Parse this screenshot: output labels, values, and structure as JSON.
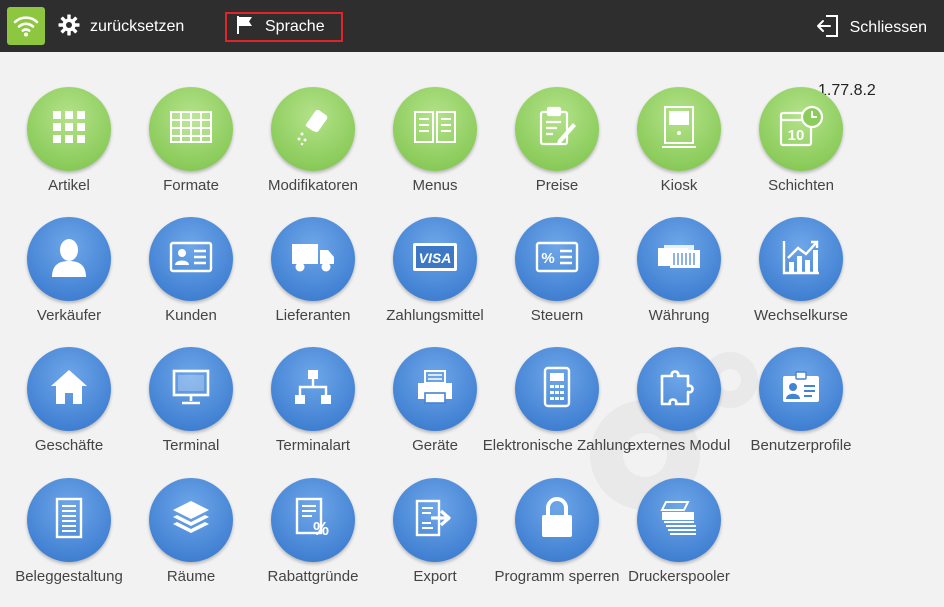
{
  "toolbar": {
    "reset_label": "zurücksetzen",
    "language_label": "Sprache",
    "close_label": "Schliessen"
  },
  "version": "1.77.8.2",
  "colors": {
    "accent_green": "#8dc63f",
    "highlight_red": "#e0242a",
    "tile_green": "#8ccc5c",
    "tile_blue": "#4483d4"
  },
  "tiles": [
    {
      "label": "Artikel",
      "icon": "grid-icon",
      "color": "green"
    },
    {
      "label": "Formate",
      "icon": "table-icon",
      "color": "green"
    },
    {
      "label": "Modifikatoren",
      "icon": "salt-shaker-icon",
      "color": "green"
    },
    {
      "label": "Menus",
      "icon": "book-icon",
      "color": "green"
    },
    {
      "label": "Preise",
      "icon": "clipboard-pencil-icon",
      "color": "green"
    },
    {
      "label": "Kiosk",
      "icon": "kiosk-icon",
      "color": "green"
    },
    {
      "label": "Schichten",
      "icon": "calendar-clock-icon",
      "color": "green"
    },
    {
      "label": "Verkäufer",
      "icon": "person-icon",
      "color": "blue"
    },
    {
      "label": "Kunden",
      "icon": "id-card-icon",
      "color": "blue"
    },
    {
      "label": "Lieferanten",
      "icon": "truck-icon",
      "color": "blue"
    },
    {
      "label": "Zahlungsmittel",
      "icon": "visa-card-icon",
      "color": "blue"
    },
    {
      "label": "Steuern",
      "icon": "percent-card-icon",
      "color": "blue"
    },
    {
      "label": "Währung",
      "icon": "money-stack-icon",
      "color": "blue"
    },
    {
      "label": "Wechselkurse",
      "icon": "chart-up-icon",
      "color": "blue"
    },
    {
      "label": "Geschäfte",
      "icon": "home-icon",
      "color": "blue"
    },
    {
      "label": "Terminal",
      "icon": "monitor-icon",
      "color": "blue"
    },
    {
      "label": "Terminalart",
      "icon": "network-icon",
      "color": "blue"
    },
    {
      "label": "Geräte",
      "icon": "printer-icon",
      "color": "blue"
    },
    {
      "label": "Elektronische Zahlung",
      "icon": "card-terminal-icon",
      "color": "blue"
    },
    {
      "label": "externes Modul",
      "icon": "puzzle-icon",
      "color": "blue"
    },
    {
      "label": "Benutzerprofile",
      "icon": "badge-icon",
      "color": "blue"
    },
    {
      "label": "Beleggestaltung",
      "icon": "receipt-icon",
      "color": "blue"
    },
    {
      "label": "Räume",
      "icon": "layers-icon",
      "color": "blue"
    },
    {
      "label": "Rabattgründe",
      "icon": "discount-doc-icon",
      "color": "blue"
    },
    {
      "label": "Export",
      "icon": "export-icon",
      "color": "blue"
    },
    {
      "label": "Programm sperren",
      "icon": "lock-icon",
      "color": "blue"
    },
    {
      "label": "Druckerspooler",
      "icon": "printer-spool-icon",
      "color": "blue"
    }
  ]
}
